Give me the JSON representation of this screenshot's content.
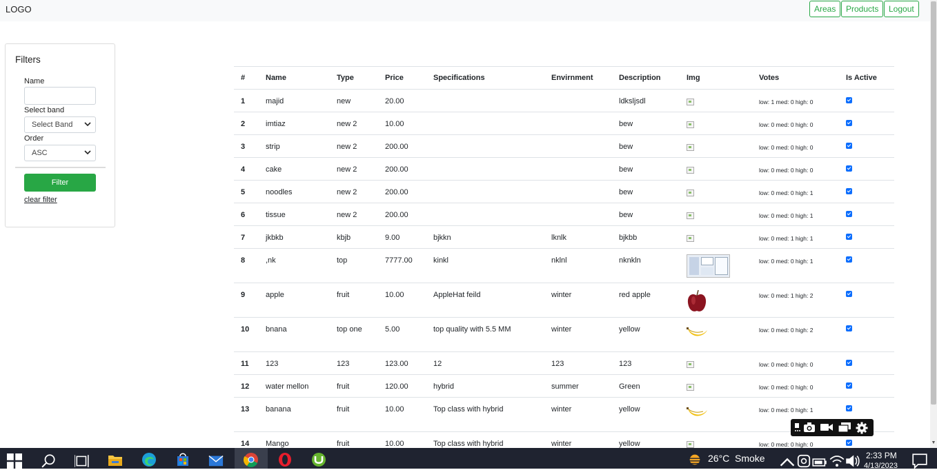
{
  "navbar": {
    "logo": "LOGO",
    "buttons": [
      "Areas",
      "Products",
      "Logout"
    ]
  },
  "filters": {
    "title": "Filters",
    "name_label": "Name",
    "name_value": "",
    "band_label": "Select band",
    "band_value": "Select Band",
    "order_label": "Order",
    "order_value": "ASC",
    "filter_button": "Filter",
    "clear_link": "clear filter"
  },
  "table": {
    "headers": [
      "#",
      "Name",
      "Type",
      "Price",
      "Specifications",
      "Envirnment",
      "Description",
      "Img",
      "Votes",
      "Is Active"
    ],
    "rows": [
      {
        "idx": "1",
        "name": "majid",
        "type": "new",
        "price": "20.00",
        "spec": "",
        "env": "",
        "desc": "ldksljsdl",
        "img": "broken",
        "votes": "low: 1 med: 0 high: 0",
        "active": true
      },
      {
        "idx": "2",
        "name": "imtiaz",
        "type": "new 2",
        "price": "10.00",
        "spec": "",
        "env": "",
        "desc": "bew",
        "img": "broken",
        "votes": "low: 0 med: 0 high: 0",
        "active": true
      },
      {
        "idx": "3",
        "name": "strip",
        "type": "new 2",
        "price": "200.00",
        "spec": "",
        "env": "",
        "desc": "bew",
        "img": "broken",
        "votes": "low: 0 med: 0 high: 0",
        "active": true
      },
      {
        "idx": "4",
        "name": "cake",
        "type": "new 2",
        "price": "200.00",
        "spec": "",
        "env": "",
        "desc": "bew",
        "img": "broken",
        "votes": "low: 0 med: 0 high: 0",
        "active": true
      },
      {
        "idx": "5",
        "name": "noodles",
        "type": "new 2",
        "price": "200.00",
        "spec": "",
        "env": "",
        "desc": "bew",
        "img": "broken",
        "votes": "low: 0 med: 0 high: 1",
        "active": true
      },
      {
        "idx": "6",
        "name": "tissue",
        "type": "new 2",
        "price": "200.00",
        "spec": "",
        "env": "",
        "desc": "bew",
        "img": "broken",
        "votes": "low: 0 med: 0 high: 1",
        "active": true
      },
      {
        "idx": "7",
        "name": "jkbkb",
        "type": "kbjb",
        "price": "9.00",
        "spec": "bjkkn",
        "env": "lknlk",
        "desc": "bjkbb",
        "img": "broken",
        "votes": "low: 0 med: 1 high: 1",
        "active": true
      },
      {
        "idx": "8",
        "name": ",nk",
        "type": "top",
        "price": "7777.00",
        "spec": "kinkl",
        "env": "nklnl",
        "desc": "nknkln",
        "img": "screenshot",
        "votes": "low: 0 med: 0 high: 1",
        "active": true
      },
      {
        "idx": "9",
        "name": "apple",
        "type": "fruit",
        "price": "10.00",
        "spec": "AppleHat feild",
        "env": "winter",
        "desc": "red apple",
        "img": "apple",
        "votes": "low: 0 med: 1 high: 2",
        "active": true
      },
      {
        "idx": "10",
        "name": "bnana",
        "type": "top one",
        "price": "5.00",
        "spec": "top quality with 5.5 MM",
        "env": "winter",
        "desc": "yellow",
        "img": "banana",
        "votes": "low: 0 med: 0 high: 2",
        "active": true
      },
      {
        "idx": "11",
        "name": "123",
        "type": "123",
        "price": "123.00",
        "spec": "12",
        "env": "123",
        "desc": "123",
        "img": "broken",
        "votes": "low: 0 med: 0 high: 0",
        "active": true
      },
      {
        "idx": "12",
        "name": "water mellon",
        "type": "fruit",
        "price": "120.00",
        "spec": "hybrid",
        "env": "summer",
        "desc": "Green",
        "img": "broken",
        "votes": "low: 0 med: 0 high: 0",
        "active": true
      },
      {
        "idx": "13",
        "name": "banana",
        "type": "fruit",
        "price": "10.00",
        "spec": "Top class with hybrid",
        "env": "winter",
        "desc": "yellow",
        "img": "banana",
        "votes": "low: 0 med: 0 high: 1",
        "active": true
      },
      {
        "idx": "14",
        "name": "Mango",
        "type": "fruit",
        "price": "10.00",
        "spec": "Top class with hybrid",
        "env": "winter",
        "desc": "yellow",
        "img": "broken",
        "votes": "low: 0 med: 0 high: 0",
        "active": true
      }
    ]
  },
  "recorder_toolbar": {
    "icons": [
      "capture-icon",
      "camera-icon",
      "video-icon",
      "windows-icon",
      "settings-icon"
    ]
  },
  "taskbar": {
    "weather_temp": "26°C",
    "weather_text": "Smoke",
    "time": "2:33 PM",
    "date": "4/13/2023"
  },
  "colors": {
    "accent_green": "#28a745",
    "checkbox_blue": "#0d6efd",
    "taskbar_bg": "#1f2330"
  }
}
